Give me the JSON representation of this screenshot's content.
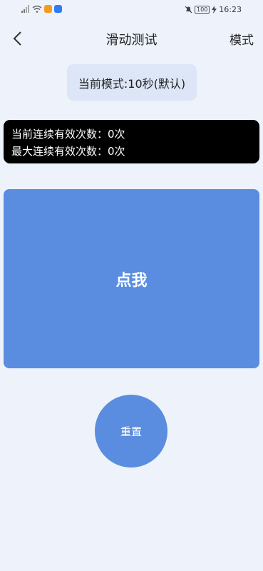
{
  "status_bar": {
    "battery": "100",
    "time": "16:23"
  },
  "header": {
    "title": "滑动测试",
    "mode_menu_label": "模式"
  },
  "mode_chip": {
    "text": "当前模式:10秒(默认)"
  },
  "stats": {
    "current_streak": "当前连续有效次数：0次",
    "max_streak": "最大连续有效次数：0次"
  },
  "tap_area": {
    "label": "点我"
  },
  "reset_button": {
    "label": "重置"
  },
  "colors": {
    "background": "#edf2fb",
    "accent": "#5a8ddf",
    "chip": "#dde6f7",
    "stats_panel": "#000000"
  }
}
